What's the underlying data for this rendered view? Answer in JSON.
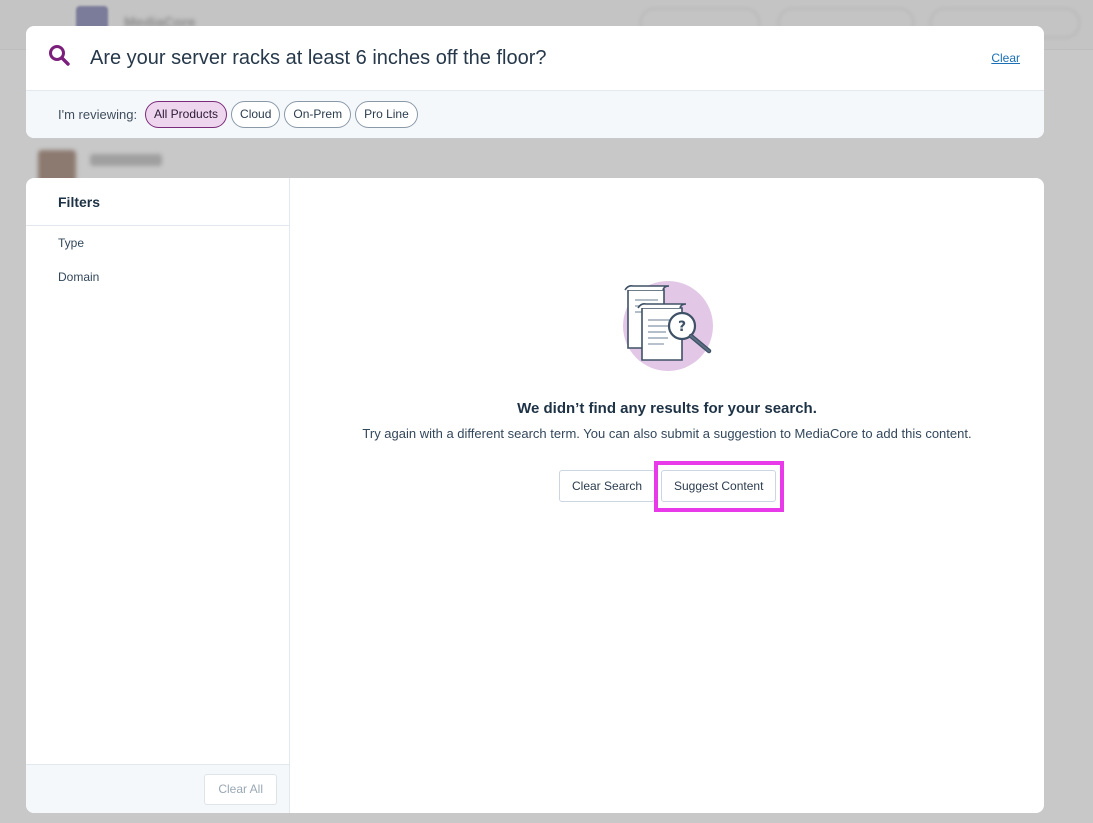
{
  "background": {
    "brand": "MediaCore"
  },
  "search": {
    "query": "Are your server racks at least 6 inches off the floor?",
    "clear_label": "Clear",
    "icon": "search-icon",
    "accent_color": "#7a1f7a"
  },
  "reviewing": {
    "label": "I'm reviewing:",
    "chips": [
      {
        "label": "All Products",
        "active": true
      },
      {
        "label": "Cloud",
        "active": false
      },
      {
        "label": "On-Prem",
        "active": false
      },
      {
        "label": "Pro Line",
        "active": false
      }
    ]
  },
  "filters": {
    "title": "Filters",
    "items": [
      "Type",
      "Domain"
    ],
    "clear_all_label": "Clear All"
  },
  "empty_state": {
    "illustration": "document-search-icon",
    "title": "We didn’t find any results for your search.",
    "description": "Try again with a different search term. You can also submit a suggestion to MediaCore to add this content.",
    "clear_search_label": "Clear Search",
    "suggest_content_label": "Suggest Content",
    "highlight_color": "#e83ae8"
  }
}
